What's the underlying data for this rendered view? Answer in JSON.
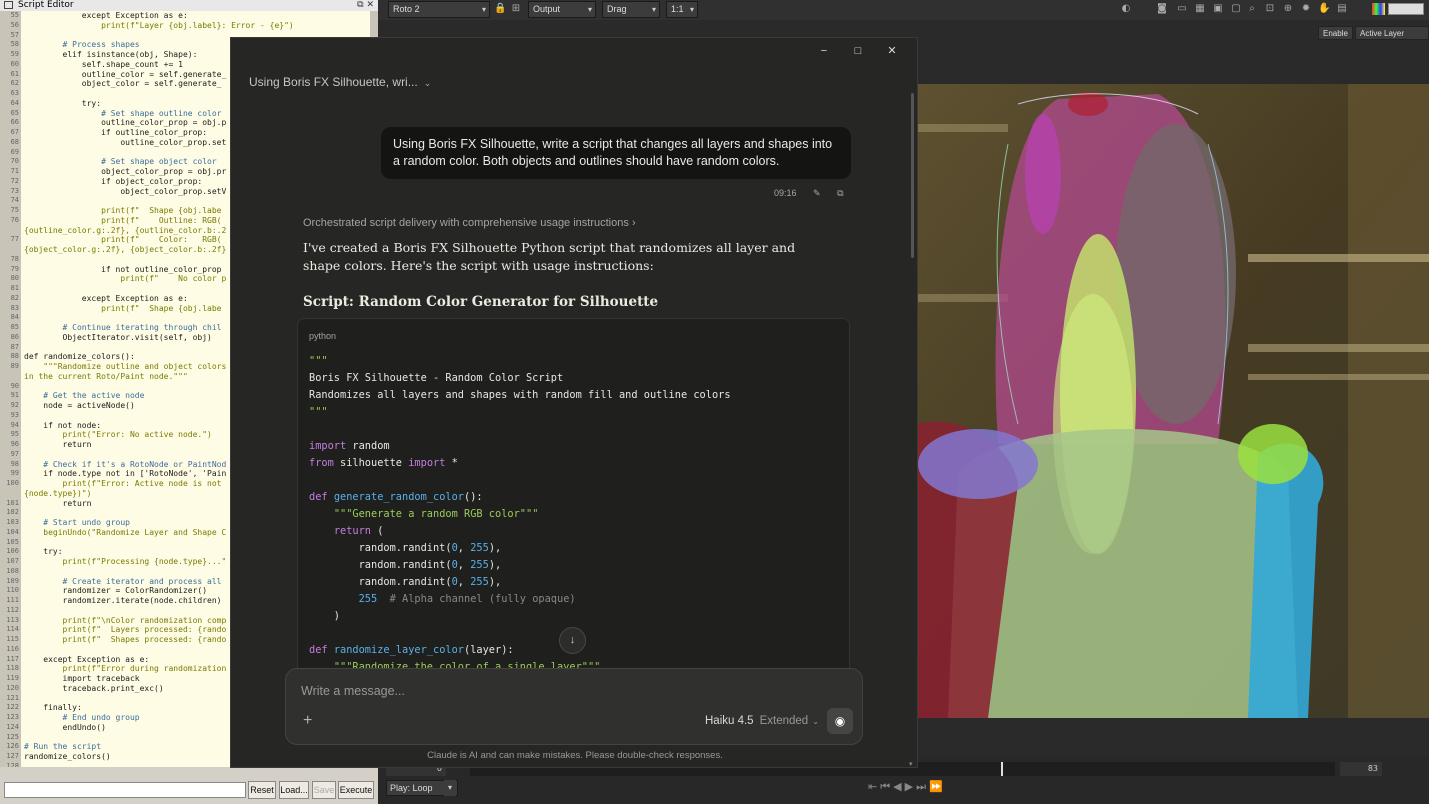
{
  "script_editor": {
    "title": "Script Editor",
    "buttons": {
      "reset": "Reset",
      "load": "Load...",
      "save": "Save",
      "execute": "Execute"
    },
    "lines": [
      {
        "n": "55",
        "t": "            except Exception as e:",
        "c": ""
      },
      {
        "n": "56",
        "t": "                print(f\"Layer {obj.label}: Error - {e}\")",
        "c": "str"
      },
      {
        "n": "57",
        "t": "",
        "c": ""
      },
      {
        "n": "58",
        "t": "        # Process shapes",
        "c": "cmt"
      },
      {
        "n": "59",
        "t": "        elif isinstance(obj, Shape):",
        "c": ""
      },
      {
        "n": "60",
        "t": "            self.shape_count += 1",
        "c": ""
      },
      {
        "n": "61",
        "t": "            outline_color = self.generate_",
        "c": ""
      },
      {
        "n": "62",
        "t": "            object_color = self.generate_",
        "c": ""
      },
      {
        "n": "63",
        "t": "",
        "c": ""
      },
      {
        "n": "64",
        "t": "            try:",
        "c": ""
      },
      {
        "n": "65",
        "t": "                # Set shape outline color",
        "c": "cmt"
      },
      {
        "n": "66",
        "t": "                outline_color_prop = obj.p",
        "c": ""
      },
      {
        "n": "67",
        "t": "                if outline_color_prop:",
        "c": ""
      },
      {
        "n": "68",
        "t": "                    outline_color_prop.set",
        "c": ""
      },
      {
        "n": "69",
        "t": "",
        "c": ""
      },
      {
        "n": "70",
        "t": "                # Set shape object color",
        "c": "cmt"
      },
      {
        "n": "71",
        "t": "                object_color_prop = obj.pr",
        "c": ""
      },
      {
        "n": "72",
        "t": "                if object_color_prop:",
        "c": ""
      },
      {
        "n": "73",
        "t": "                    object_color_prop.setV",
        "c": ""
      },
      {
        "n": "74",
        "t": "",
        "c": ""
      },
      {
        "n": "75",
        "t": "                print(f\"  Shape {obj.labe",
        "c": "str"
      },
      {
        "n": "76",
        "t": "                print(f\"    Outline: RGB(",
        "c": "str"
      },
      {
        "n": "",
        "t": "{outline_color.g:.2f}, {outline_color.b:.2",
        "c": "str"
      },
      {
        "n": "77",
        "t": "                print(f\"    Color:   RGB(",
        "c": "str"
      },
      {
        "n": "",
        "t": "{object_color.g:.2f}, {object_color.b:.2f}",
        "c": "str"
      },
      {
        "n": "78",
        "t": "",
        "c": ""
      },
      {
        "n": "79",
        "t": "                if not outline_color_prop",
        "c": ""
      },
      {
        "n": "80",
        "t": "                    print(f\"    No color p",
        "c": "str"
      },
      {
        "n": "81",
        "t": "",
        "c": ""
      },
      {
        "n": "82",
        "t": "            except Exception as e:",
        "c": ""
      },
      {
        "n": "83",
        "t": "                print(f\"  Shape {obj.labe",
        "c": "str"
      },
      {
        "n": "84",
        "t": "",
        "c": ""
      },
      {
        "n": "85",
        "t": "        # Continue iterating through chil",
        "c": "cmt"
      },
      {
        "n": "86",
        "t": "        ObjectIterator.visit(self, obj)",
        "c": ""
      },
      {
        "n": "87",
        "t": "",
        "c": ""
      },
      {
        "n": "88",
        "t": "def randomize_colors():",
        "c": ""
      },
      {
        "n": "89",
        "t": "    \"\"\"Randomize outline and object colors",
        "c": "str"
      },
      {
        "n": "",
        "t": "in the current Roto/Paint node.\"\"\"",
        "c": "str"
      },
      {
        "n": "90",
        "t": "",
        "c": ""
      },
      {
        "n": "91",
        "t": "    # Get the active node",
        "c": "cmt"
      },
      {
        "n": "92",
        "t": "    node = activeNode()",
        "c": ""
      },
      {
        "n": "93",
        "t": "",
        "c": ""
      },
      {
        "n": "94",
        "t": "    if not node:",
        "c": ""
      },
      {
        "n": "95",
        "t": "        print(\"Error: No active node.\")",
        "c": "str"
      },
      {
        "n": "96",
        "t": "        return",
        "c": ""
      },
      {
        "n": "97",
        "t": "",
        "c": ""
      },
      {
        "n": "98",
        "t": "    # Check if it's a RotoNode or PaintNod",
        "c": "cmt"
      },
      {
        "n": "99",
        "t": "    if node.type not in ['RotoNode', 'Pain",
        "c": ""
      },
      {
        "n": "100",
        "t": "        print(f\"Error: Active node is not",
        "c": "str"
      },
      {
        "n": "",
        "t": "{node.type})\")",
        "c": "str"
      },
      {
        "n": "101",
        "t": "        return",
        "c": ""
      },
      {
        "n": "102",
        "t": "",
        "c": ""
      },
      {
        "n": "103",
        "t": "    # Start undo group",
        "c": "cmt"
      },
      {
        "n": "104",
        "t": "    beginUndo(\"Randomize Layer and Shape C",
        "c": "str"
      },
      {
        "n": "105",
        "t": "",
        "c": ""
      },
      {
        "n": "106",
        "t": "    try:",
        "c": ""
      },
      {
        "n": "107",
        "t": "        print(f\"Processing {node.type}...\"",
        "c": "str"
      },
      {
        "n": "108",
        "t": "",
        "c": ""
      },
      {
        "n": "109",
        "t": "        # Create iterator and process all",
        "c": "cmt"
      },
      {
        "n": "110",
        "t": "        randomizer = ColorRandomizer()",
        "c": ""
      },
      {
        "n": "111",
        "t": "        randomizer.iterate(node.children)",
        "c": ""
      },
      {
        "n": "112",
        "t": "",
        "c": ""
      },
      {
        "n": "113",
        "t": "        print(f\"\\nColor randomization comp",
        "c": "str"
      },
      {
        "n": "114",
        "t": "        print(f\"  Layers processed: {rando",
        "c": "str"
      },
      {
        "n": "115",
        "t": "        print(f\"  Shapes processed: {rando",
        "c": "str"
      },
      {
        "n": "116",
        "t": "",
        "c": ""
      },
      {
        "n": "117",
        "t": "    except Exception as e:",
        "c": ""
      },
      {
        "n": "118",
        "t": "        print(f\"Error during randomization",
        "c": "str"
      },
      {
        "n": "119",
        "t": "        import traceback",
        "c": ""
      },
      {
        "n": "120",
        "t": "        traceback.print_exc()",
        "c": ""
      },
      {
        "n": "121",
        "t": "",
        "c": ""
      },
      {
        "n": "122",
        "t": "    finally:",
        "c": ""
      },
      {
        "n": "123",
        "t": "        # End undo group",
        "c": "cmt"
      },
      {
        "n": "124",
        "t": "        endUndo()",
        "c": ""
      },
      {
        "n": "125",
        "t": "",
        "c": ""
      },
      {
        "n": "126",
        "t": "# Run the script",
        "c": "cmt"
      },
      {
        "n": "127",
        "t": "randomize_colors()",
        "c": ""
      },
      {
        "n": "128",
        "t": "",
        "c": ""
      }
    ]
  },
  "viewer": {
    "node_select": "Roto 2",
    "output_select": "Output",
    "drag_select": "Drag",
    "zoom_select": "1:1",
    "enable_label": "Enable",
    "active_layer_label": "Active Layer",
    "play_mode": "Play: Loop",
    "frame_start": "0",
    "frame_current": "83"
  },
  "claude": {
    "window_controls": [
      "−",
      "□",
      "✕"
    ],
    "conversation_title": "Using Boris FX Silhouette, wri...",
    "user_message": "Using Boris FX Silhouette, write a script that changes all layers and shapes into a random color. Both objects and outlines should have random colors.",
    "timestamp": "09:16",
    "thinking_summary": "Orchestrated script delivery with comprehensive usage instructions",
    "reply_text": "I've created a Boris FX Silhouette Python script that randomizes all layer and shape colors. Here's the script with usage instructions:",
    "reply_heading": "Script: Random Color Generator for Silhouette",
    "code_language": "python",
    "code_lines": [
      [
        {
          "t": "\"\"\"",
          "k": "str"
        }
      ],
      [
        {
          "t": "Boris FX Silhouette - Random Color Script",
          "k": ""
        }
      ],
      [
        {
          "t": "Randomizes all layers and shapes with random fill and outline colors",
          "k": ""
        }
      ],
      [
        {
          "t": "\"\"\"",
          "k": "str"
        }
      ],
      [
        {
          "t": "",
          "k": ""
        }
      ],
      [
        {
          "t": "import",
          "k": "kw"
        },
        {
          "t": " random",
          "k": ""
        }
      ],
      [
        {
          "t": "from",
          "k": "kw"
        },
        {
          "t": " silhouette ",
          "k": ""
        },
        {
          "t": "import",
          "k": "kw"
        },
        {
          "t": " *",
          "k": ""
        }
      ],
      [
        {
          "t": "",
          "k": ""
        }
      ],
      [
        {
          "t": "def",
          "k": "kw"
        },
        {
          "t": " ",
          "k": ""
        },
        {
          "t": "generate_random_color",
          "k": "fn"
        },
        {
          "t": "():",
          "k": ""
        }
      ],
      [
        {
          "t": "    ",
          "k": ""
        },
        {
          "t": "\"\"\"Generate a random RGB color\"\"\"",
          "k": "str"
        }
      ],
      [
        {
          "t": "    ",
          "k": ""
        },
        {
          "t": "return",
          "k": "kw"
        },
        {
          "t": " (",
          "k": ""
        }
      ],
      [
        {
          "t": "        random.randint(",
          "k": ""
        },
        {
          "t": "0",
          "k": "num"
        },
        {
          "t": ", ",
          "k": ""
        },
        {
          "t": "255",
          "k": "num"
        },
        {
          "t": "),",
          "k": ""
        }
      ],
      [
        {
          "t": "        random.randint(",
          "k": ""
        },
        {
          "t": "0",
          "k": "num"
        },
        {
          "t": ", ",
          "k": ""
        },
        {
          "t": "255",
          "k": "num"
        },
        {
          "t": "),",
          "k": ""
        }
      ],
      [
        {
          "t": "        random.randint(",
          "k": ""
        },
        {
          "t": "0",
          "k": "num"
        },
        {
          "t": ", ",
          "k": ""
        },
        {
          "t": "255",
          "k": "num"
        },
        {
          "t": "),",
          "k": ""
        }
      ],
      [
        {
          "t": "        ",
          "k": ""
        },
        {
          "t": "255",
          "k": "num"
        },
        {
          "t": "  ",
          "k": ""
        },
        {
          "t": "# Alpha channel (fully opaque)",
          "k": "cmt"
        }
      ],
      [
        {
          "t": "    )",
          "k": ""
        }
      ],
      [
        {
          "t": "",
          "k": ""
        }
      ],
      [
        {
          "t": "def",
          "k": "kw"
        },
        {
          "t": " ",
          "k": ""
        },
        {
          "t": "randomize_layer_color",
          "k": "fn"
        },
        {
          "t": "(layer):",
          "k": ""
        }
      ],
      [
        {
          "t": "    ",
          "k": ""
        },
        {
          "t": "\"\"\"Randomize the color of a single layer\"\"\"",
          "k": "str"
        }
      ]
    ],
    "composer_placeholder": "Write a message...",
    "model_name": "Haiku 4.5",
    "model_mode": "Extended",
    "disclaimer": "Claude is AI and can make mistakes. Please double-check responses."
  }
}
